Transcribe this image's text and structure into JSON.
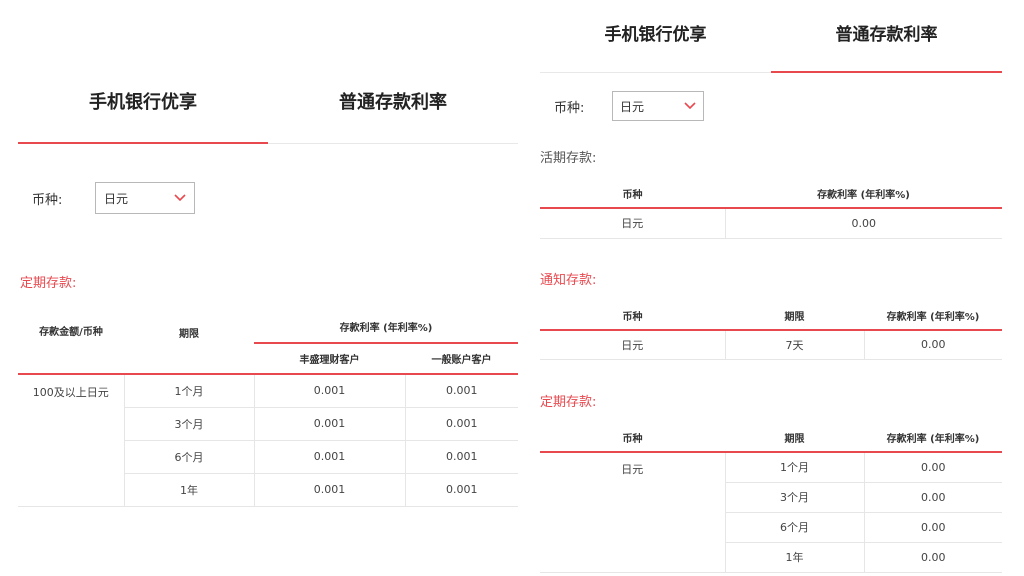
{
  "left_panel": {
    "tabs": [
      {
        "label": "手机银行优享",
        "active": true
      },
      {
        "label": "普通存款利率",
        "active": false
      }
    ],
    "currency": {
      "label": "币种:",
      "value": "日元"
    },
    "fixed": {
      "title": "定期存款:",
      "headers": {
        "amount": "存款金额/币种",
        "term": "期限",
        "rate": "存款利率 (年利率%)",
        "vip": "丰盛理财客户",
        "normal": "一般账户客户"
      },
      "amount_cell": "100及以上日元",
      "rows": [
        {
          "term": "1个月",
          "vip": "0.001",
          "normal": "0.001"
        },
        {
          "term": "3个月",
          "vip": "0.001",
          "normal": "0.001"
        },
        {
          "term": "6个月",
          "vip": "0.001",
          "normal": "0.001"
        },
        {
          "term": "1年",
          "vip": "0.001",
          "normal": "0.001"
        }
      ]
    }
  },
  "right_panel": {
    "tabs": [
      {
        "label": "手机银行优享",
        "active": false
      },
      {
        "label": "普通存款利率",
        "active": true
      }
    ],
    "currency": {
      "label": "币种:",
      "value": "日元"
    },
    "demand": {
      "title": "活期存款:",
      "headers": {
        "currency": "币种",
        "rate": "存款利率 (年利率%)"
      },
      "rows": [
        {
          "currency": "日元",
          "rate": "0.00"
        }
      ]
    },
    "notice": {
      "title": "通知存款:",
      "headers": {
        "currency": "币种",
        "term": "期限",
        "rate": "存款利率 (年利率%)"
      },
      "rows": [
        {
          "currency": "日元",
          "term": "7天",
          "rate": "0.00"
        }
      ]
    },
    "fixed": {
      "title": "定期存款:",
      "headers": {
        "currency": "币种",
        "term": "期限",
        "rate": "存款利率 (年利率%)"
      },
      "currency_cell": "日元",
      "rows": [
        {
          "term": "1个月",
          "rate": "0.00"
        },
        {
          "term": "3个月",
          "rate": "0.00"
        },
        {
          "term": "6个月",
          "rate": "0.00"
        },
        {
          "term": "1年",
          "rate": "0.00"
        }
      ]
    }
  },
  "colors": {
    "accent": "#e8494f",
    "border": "#e6e6e6"
  },
  "icons": {
    "dropdown": "chevron-down-icon"
  }
}
